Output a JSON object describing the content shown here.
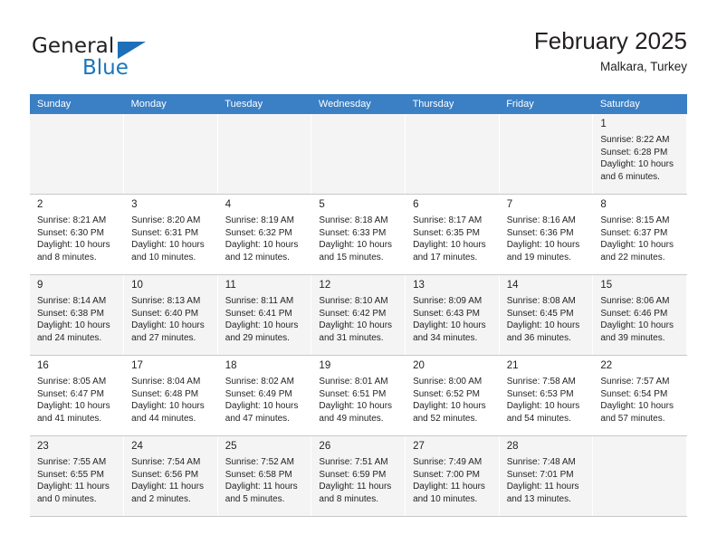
{
  "brand": {
    "name_part1": "General",
    "name_part2": "Blue",
    "triangle_color": "#1c6fb8",
    "blue_color": "#1b75bb"
  },
  "header": {
    "title": "February 2025",
    "subtitle": "Malkara, Turkey"
  },
  "calendar": {
    "header_bg": "#3b7fc4",
    "weekdays": [
      "Sunday",
      "Monday",
      "Tuesday",
      "Wednesday",
      "Thursday",
      "Friday",
      "Saturday"
    ],
    "weeks": [
      [
        {
          "empty": true
        },
        {
          "empty": true
        },
        {
          "empty": true
        },
        {
          "empty": true
        },
        {
          "empty": true
        },
        {
          "empty": true
        },
        {
          "day": "1",
          "sunrise": "Sunrise: 8:22 AM",
          "sunset": "Sunset: 6:28 PM",
          "daylight_line1": "Daylight: 10 hours",
          "daylight_line2": "and 6 minutes."
        }
      ],
      [
        {
          "day": "2",
          "sunrise": "Sunrise: 8:21 AM",
          "sunset": "Sunset: 6:30 PM",
          "daylight_line1": "Daylight: 10 hours",
          "daylight_line2": "and 8 minutes."
        },
        {
          "day": "3",
          "sunrise": "Sunrise: 8:20 AM",
          "sunset": "Sunset: 6:31 PM",
          "daylight_line1": "Daylight: 10 hours",
          "daylight_line2": "and 10 minutes."
        },
        {
          "day": "4",
          "sunrise": "Sunrise: 8:19 AM",
          "sunset": "Sunset: 6:32 PM",
          "daylight_line1": "Daylight: 10 hours",
          "daylight_line2": "and 12 minutes."
        },
        {
          "day": "5",
          "sunrise": "Sunrise: 8:18 AM",
          "sunset": "Sunset: 6:33 PM",
          "daylight_line1": "Daylight: 10 hours",
          "daylight_line2": "and 15 minutes."
        },
        {
          "day": "6",
          "sunrise": "Sunrise: 8:17 AM",
          "sunset": "Sunset: 6:35 PM",
          "daylight_line1": "Daylight: 10 hours",
          "daylight_line2": "and 17 minutes."
        },
        {
          "day": "7",
          "sunrise": "Sunrise: 8:16 AM",
          "sunset": "Sunset: 6:36 PM",
          "daylight_line1": "Daylight: 10 hours",
          "daylight_line2": "and 19 minutes."
        },
        {
          "day": "8",
          "sunrise": "Sunrise: 8:15 AM",
          "sunset": "Sunset: 6:37 PM",
          "daylight_line1": "Daylight: 10 hours",
          "daylight_line2": "and 22 minutes."
        }
      ],
      [
        {
          "day": "9",
          "sunrise": "Sunrise: 8:14 AM",
          "sunset": "Sunset: 6:38 PM",
          "daylight_line1": "Daylight: 10 hours",
          "daylight_line2": "and 24 minutes."
        },
        {
          "day": "10",
          "sunrise": "Sunrise: 8:13 AM",
          "sunset": "Sunset: 6:40 PM",
          "daylight_line1": "Daylight: 10 hours",
          "daylight_line2": "and 27 minutes."
        },
        {
          "day": "11",
          "sunrise": "Sunrise: 8:11 AM",
          "sunset": "Sunset: 6:41 PM",
          "daylight_line1": "Daylight: 10 hours",
          "daylight_line2": "and 29 minutes."
        },
        {
          "day": "12",
          "sunrise": "Sunrise: 8:10 AM",
          "sunset": "Sunset: 6:42 PM",
          "daylight_line1": "Daylight: 10 hours",
          "daylight_line2": "and 31 minutes."
        },
        {
          "day": "13",
          "sunrise": "Sunrise: 8:09 AM",
          "sunset": "Sunset: 6:43 PM",
          "daylight_line1": "Daylight: 10 hours",
          "daylight_line2": "and 34 minutes."
        },
        {
          "day": "14",
          "sunrise": "Sunrise: 8:08 AM",
          "sunset": "Sunset: 6:45 PM",
          "daylight_line1": "Daylight: 10 hours",
          "daylight_line2": "and 36 minutes."
        },
        {
          "day": "15",
          "sunrise": "Sunrise: 8:06 AM",
          "sunset": "Sunset: 6:46 PM",
          "daylight_line1": "Daylight: 10 hours",
          "daylight_line2": "and 39 minutes."
        }
      ],
      [
        {
          "day": "16",
          "sunrise": "Sunrise: 8:05 AM",
          "sunset": "Sunset: 6:47 PM",
          "daylight_line1": "Daylight: 10 hours",
          "daylight_line2": "and 41 minutes."
        },
        {
          "day": "17",
          "sunrise": "Sunrise: 8:04 AM",
          "sunset": "Sunset: 6:48 PM",
          "daylight_line1": "Daylight: 10 hours",
          "daylight_line2": "and 44 minutes."
        },
        {
          "day": "18",
          "sunrise": "Sunrise: 8:02 AM",
          "sunset": "Sunset: 6:49 PM",
          "daylight_line1": "Daylight: 10 hours",
          "daylight_line2": "and 47 minutes."
        },
        {
          "day": "19",
          "sunrise": "Sunrise: 8:01 AM",
          "sunset": "Sunset: 6:51 PM",
          "daylight_line1": "Daylight: 10 hours",
          "daylight_line2": "and 49 minutes."
        },
        {
          "day": "20",
          "sunrise": "Sunrise: 8:00 AM",
          "sunset": "Sunset: 6:52 PM",
          "daylight_line1": "Daylight: 10 hours",
          "daylight_line2": "and 52 minutes."
        },
        {
          "day": "21",
          "sunrise": "Sunrise: 7:58 AM",
          "sunset": "Sunset: 6:53 PM",
          "daylight_line1": "Daylight: 10 hours",
          "daylight_line2": "and 54 minutes."
        },
        {
          "day": "22",
          "sunrise": "Sunrise: 7:57 AM",
          "sunset": "Sunset: 6:54 PM",
          "daylight_line1": "Daylight: 10 hours",
          "daylight_line2": "and 57 minutes."
        }
      ],
      [
        {
          "day": "23",
          "sunrise": "Sunrise: 7:55 AM",
          "sunset": "Sunset: 6:55 PM",
          "daylight_line1": "Daylight: 11 hours",
          "daylight_line2": "and 0 minutes."
        },
        {
          "day": "24",
          "sunrise": "Sunrise: 7:54 AM",
          "sunset": "Sunset: 6:56 PM",
          "daylight_line1": "Daylight: 11 hours",
          "daylight_line2": "and 2 minutes."
        },
        {
          "day": "25",
          "sunrise": "Sunrise: 7:52 AM",
          "sunset": "Sunset: 6:58 PM",
          "daylight_line1": "Daylight: 11 hours",
          "daylight_line2": "and 5 minutes."
        },
        {
          "day": "26",
          "sunrise": "Sunrise: 7:51 AM",
          "sunset": "Sunset: 6:59 PM",
          "daylight_line1": "Daylight: 11 hours",
          "daylight_line2": "and 8 minutes."
        },
        {
          "day": "27",
          "sunrise": "Sunrise: 7:49 AM",
          "sunset": "Sunset: 7:00 PM",
          "daylight_line1": "Daylight: 11 hours",
          "daylight_line2": "and 10 minutes."
        },
        {
          "day": "28",
          "sunrise": "Sunrise: 7:48 AM",
          "sunset": "Sunset: 7:01 PM",
          "daylight_line1": "Daylight: 11 hours",
          "daylight_line2": "and 13 minutes."
        },
        {
          "empty": true
        }
      ]
    ]
  }
}
